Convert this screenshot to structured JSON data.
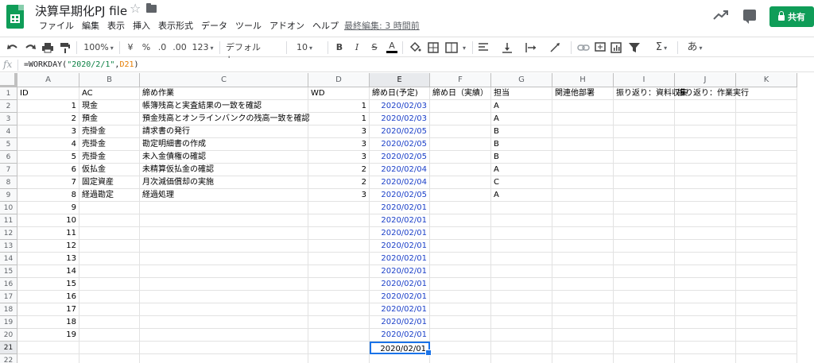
{
  "doc": {
    "title": "決算早期化PJ file",
    "last_edit": "最終編集: 3 時間前",
    "share_label": "共有"
  },
  "menu": [
    "ファイル",
    "編集",
    "表示",
    "挿入",
    "表示形式",
    "データ",
    "ツール",
    "アドオン",
    "ヘルプ"
  ],
  "toolbar": {
    "zoom": "100%",
    "currency": "¥",
    "percent": "%",
    "dec_decrease": ".0",
    "dec_increase": ".00",
    "more_formats": "123",
    "font": "デフォルト...",
    "font_size": "10",
    "bold": "B",
    "italic": "I",
    "strike": "S",
    "text_color": "A",
    "input_tools": "あ"
  },
  "formula_bar": {
    "fx": "fx",
    "prefix": "=WORKDAY(",
    "str_arg": "\"2020/2/1\"",
    "comma": ",",
    "ref_arg": "D21",
    "suffix": ")"
  },
  "columns": [
    "A",
    "B",
    "C",
    "D",
    "E",
    "F",
    "G",
    "H",
    "I",
    "J",
    "K"
  ],
  "active_column": "E",
  "active_row": 21,
  "rows": [
    1,
    2,
    3,
    4,
    5,
    6,
    7,
    8,
    9,
    10,
    11,
    12,
    13,
    14,
    15,
    16,
    17,
    18,
    19,
    20,
    21,
    22
  ],
  "sheet": {
    "headers": [
      "ID",
      "AC",
      "締め作業",
      "WD",
      "締め日(予定)",
      "締め日（実績）",
      "担当",
      "関連他部署",
      "振り返り：資料収集",
      "振り返り：作業実行",
      ""
    ],
    "data": [
      {
        "id": "1",
        "ac": "現金",
        "task": "帳簿残高と実査結果の一致を確認",
        "wd": "1",
        "plan": "2020/02/03",
        "owner": "A"
      },
      {
        "id": "2",
        "ac": "預金",
        "task": "預金残高とオンラインバンクの残高一致を確認",
        "wd": "1",
        "plan": "2020/02/03",
        "owner": "A"
      },
      {
        "id": "3",
        "ac": "売掛金",
        "task": "請求書の発行",
        "wd": "3",
        "plan": "2020/02/05",
        "owner": "B"
      },
      {
        "id": "4",
        "ac": "売掛金",
        "task": "勘定明細書の作成",
        "wd": "3",
        "plan": "2020/02/05",
        "owner": "B"
      },
      {
        "id": "5",
        "ac": "売掛金",
        "task": "未入金債権の確認",
        "wd": "3",
        "plan": "2020/02/05",
        "owner": "B"
      },
      {
        "id": "6",
        "ac": "仮払金",
        "task": "未精算仮払金の確認",
        "wd": "2",
        "plan": "2020/02/04",
        "owner": "A"
      },
      {
        "id": "7",
        "ac": "固定資産",
        "task": "月次減価償却の実施",
        "wd": "2",
        "plan": "2020/02/04",
        "owner": "C"
      },
      {
        "id": "8",
        "ac": "経過勘定",
        "task": "経過処理",
        "wd": "3",
        "plan": "2020/02/05",
        "owner": "A"
      },
      {
        "id": "9",
        "ac": "",
        "task": "",
        "wd": "",
        "plan": "2020/02/01",
        "owner": ""
      },
      {
        "id": "10",
        "ac": "",
        "task": "",
        "wd": "",
        "plan": "2020/02/01",
        "owner": ""
      },
      {
        "id": "11",
        "ac": "",
        "task": "",
        "wd": "",
        "plan": "2020/02/01",
        "owner": ""
      },
      {
        "id": "12",
        "ac": "",
        "task": "",
        "wd": "",
        "plan": "2020/02/01",
        "owner": ""
      },
      {
        "id": "13",
        "ac": "",
        "task": "",
        "wd": "",
        "plan": "2020/02/01",
        "owner": ""
      },
      {
        "id": "14",
        "ac": "",
        "task": "",
        "wd": "",
        "plan": "2020/02/01",
        "owner": ""
      },
      {
        "id": "15",
        "ac": "",
        "task": "",
        "wd": "",
        "plan": "2020/02/01",
        "owner": ""
      },
      {
        "id": "16",
        "ac": "",
        "task": "",
        "wd": "",
        "plan": "2020/02/01",
        "owner": ""
      },
      {
        "id": "17",
        "ac": "",
        "task": "",
        "wd": "",
        "plan": "2020/02/01",
        "owner": ""
      },
      {
        "id": "18",
        "ac": "",
        "task": "",
        "wd": "",
        "plan": "2020/02/01",
        "owner": ""
      },
      {
        "id": "19",
        "ac": "",
        "task": "",
        "wd": "",
        "plan": "2020/02/01",
        "owner": ""
      },
      {
        "id": "",
        "ac": "",
        "task": "",
        "wd": "",
        "plan": "2020/02/01",
        "owner": ""
      },
      {
        "id": "",
        "ac": "",
        "task": "",
        "wd": "",
        "plan": "",
        "owner": ""
      }
    ]
  },
  "colors": {
    "brand": "#0f9d58",
    "date_text": "#1a3fc8",
    "selection": "#1a73e8"
  }
}
